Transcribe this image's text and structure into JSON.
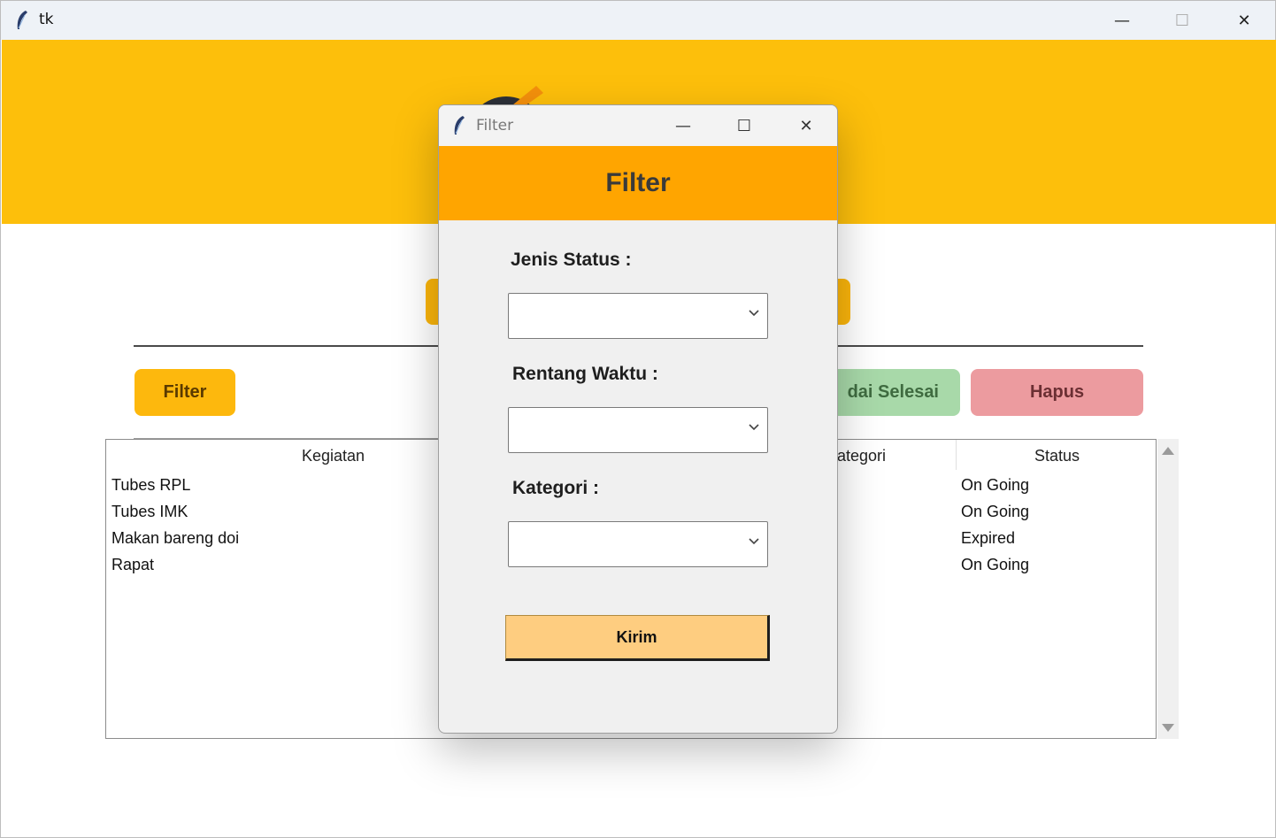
{
  "window": {
    "title": "tk",
    "minimize_glyph": "—",
    "maximize_glyph": "☐",
    "close_glyph": "✕"
  },
  "main": {
    "buttons": {
      "filter": "Filter",
      "selesai": "dai Selesai",
      "hapus": "Hapus"
    },
    "table": {
      "headers": {
        "kegiatan": "Kegiatan",
        "kategori": "ategori",
        "status": "Status"
      },
      "rows": [
        {
          "kegiatan": "Tubes RPL",
          "status": "On Going"
        },
        {
          "kegiatan": "Tubes IMK",
          "status": "On Going"
        },
        {
          "kegiatan": "Makan bareng doi",
          "status": "Expired"
        },
        {
          "kegiatan": "Rapat",
          "status": "On Going"
        }
      ]
    }
  },
  "dialog": {
    "title": "Filter",
    "heading": "Filter",
    "fields": [
      {
        "label": "Jenis Status :",
        "value": ""
      },
      {
        "label": "Rentang Waktu :",
        "value": ""
      },
      {
        "label": "Kategori :",
        "value": ""
      }
    ],
    "submit": "Kirim"
  },
  "colors": {
    "header_yellow": "#fdbf0b",
    "dialog_orange": "#ffa500",
    "kirim_bg": "#fecd80",
    "selesai_green": "#a8d9a9",
    "hapus_red": "#ec9b9f"
  },
  "icons": [
    "feather-icon",
    "minimize-icon",
    "maximize-icon",
    "close-icon",
    "chevron-down-icon",
    "scroll-up-icon",
    "scroll-down-icon"
  ]
}
